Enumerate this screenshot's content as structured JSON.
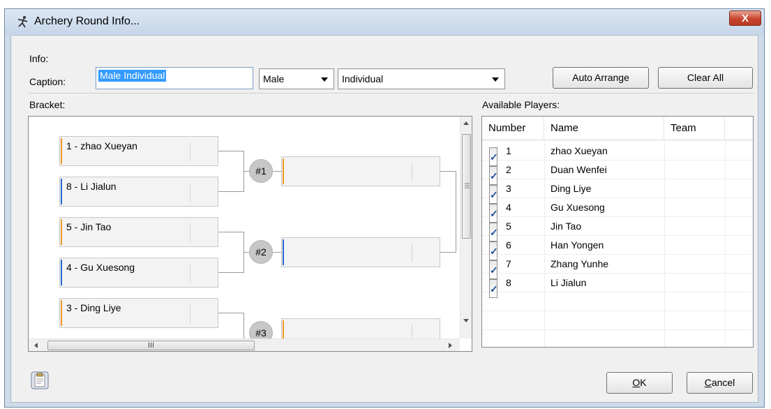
{
  "window": {
    "title": "Archery Round Info...",
    "close_label": "X"
  },
  "info": {
    "group_label": "Info:",
    "caption_label": "Caption:",
    "caption_value": "Male Individual",
    "gender_value": "Male",
    "type_value": "Individual",
    "auto_arrange_label": "Auto Arrange",
    "clear_all_label": "Clear All"
  },
  "bracket": {
    "label": "Bracket:",
    "players": [
      {
        "text": "1 - zhao Xueyan",
        "color": "#f29a25"
      },
      {
        "text": "8 - Li Jialun",
        "color": "#2a67d6"
      },
      {
        "text": "5 - Jin Tao",
        "color": "#f29a25"
      },
      {
        "text": "4 - Gu Xuesong",
        "color": "#2a67d6"
      },
      {
        "text": "3 - Ding Liye",
        "color": "#f29a25"
      }
    ],
    "matches": [
      "#1",
      "#2",
      "#3"
    ],
    "hscroll_grip": "III"
  },
  "available_players": {
    "label": "Available Players:",
    "columns": [
      "Number",
      "Name",
      "Team"
    ],
    "rows": [
      {
        "checked": "✓",
        "number": "1",
        "name": "zhao Xueyan",
        "team": ""
      },
      {
        "checked": "✓",
        "number": "2",
        "name": "Duan Wenfei",
        "team": ""
      },
      {
        "checked": "✓",
        "number": "3",
        "name": "Ding Liye",
        "team": ""
      },
      {
        "checked": "✓",
        "number": "4",
        "name": "Gu Xuesong",
        "team": ""
      },
      {
        "checked": "✓",
        "number": "5",
        "name": "Jin Tao",
        "team": ""
      },
      {
        "checked": "✓",
        "number": "6",
        "name": "Han Yongen",
        "team": ""
      },
      {
        "checked": "✓",
        "number": "7",
        "name": "Zhang Yunhe",
        "team": ""
      },
      {
        "checked": "✓",
        "number": "8",
        "name": "Li Jialun",
        "team": ""
      }
    ]
  },
  "footer": {
    "ok_accel": "O",
    "ok_rest": "K",
    "cancel_accel": "C",
    "cancel_rest": "ancel"
  },
  "icons": {
    "app": "archer-icon",
    "clipboard": "clipboard-icon"
  },
  "colors": {
    "accent_orange": "#f29a25",
    "accent_blue": "#2a67d6",
    "selection": "#3399ff"
  }
}
